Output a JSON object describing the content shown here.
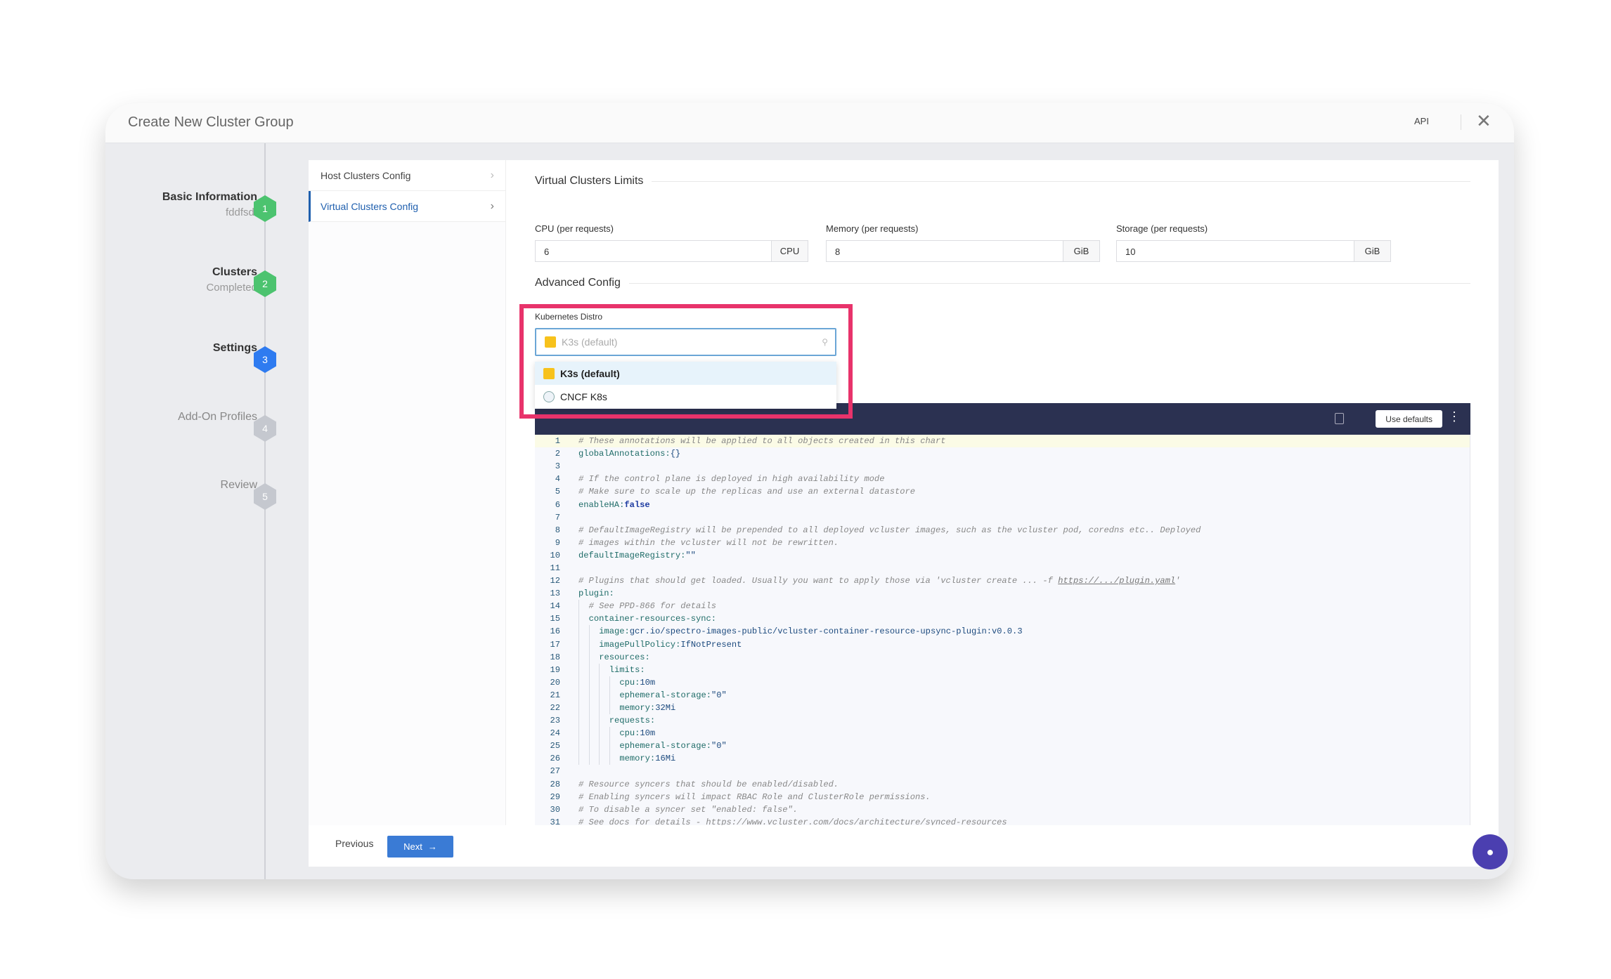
{
  "header": {
    "title": "Create New Cluster Group",
    "api": "API"
  },
  "steps": [
    {
      "label": "Basic Information",
      "sub": "fddfsdf",
      "num": "1",
      "color": "#4cc36f"
    },
    {
      "label": "Clusters",
      "sub": "Completed",
      "num": "2",
      "color": "#4cc36f"
    },
    {
      "label": "Settings",
      "sub": "",
      "num": "3",
      "color": "#2e7bf0"
    },
    {
      "label": "Add-On Profiles",
      "sub": "",
      "num": "4",
      "color": "#c5c8cf"
    },
    {
      "label": "Review",
      "sub": "",
      "num": "5",
      "color": "#c5c8cf"
    }
  ],
  "subnav": [
    {
      "label": "Host Clusters Config"
    },
    {
      "label": "Virtual Clusters Config",
      "active": true
    }
  ],
  "limits": {
    "title": "Virtual Clusters Limits",
    "cpu": {
      "label": "CPU (per requests)",
      "value": "6",
      "unit": "CPU"
    },
    "memory": {
      "label": "Memory (per requests)",
      "value": "8",
      "unit": "GiB"
    },
    "storage": {
      "label": "Storage (per requests)",
      "value": "10",
      "unit": "GiB"
    }
  },
  "advanced": {
    "title": "Advanced Config",
    "distro_label": "Kubernetes Distro",
    "distro_placeholder": "K3s (default)",
    "options": [
      {
        "label": "K3s (default)",
        "icon": "k3s-icon",
        "selected": true
      },
      {
        "label": "CNCF K8s",
        "icon": "cncf-icon"
      }
    ],
    "highlight_color": "#e8336b"
  },
  "editor": {
    "use_defaults": "Use defaults",
    "lines": [
      {
        "c": "# These annotations will be applied to all objects created in this chart"
      },
      {
        "k": "globalAnnotations",
        "v": "{}"
      },
      {},
      {
        "c": "# If the control plane is deployed in high availability mode"
      },
      {
        "c": "# Make sure to scale up the replicas and use an external datastore"
      },
      {
        "k": "enableHA",
        "b": "false"
      },
      {},
      {
        "c": "# DefaultImageRegistry will be prepended to all deployed vcluster images, such as the vcluster pod, coredns etc.. Deployed"
      },
      {
        "c": "# images within the vcluster will not be rewritten."
      },
      {
        "k": "defaultImageRegistry",
        "v": "\"\""
      },
      {},
      {
        "c": "# Plugins that should get loaded. Usually you want to apply those via 'vcluster create ... -f ",
        "link": "https://.../plugin.yaml",
        "c2": "'"
      },
      {
        "k": "plugin"
      },
      {
        "i": 1,
        "c": "# See PPD-866 for details"
      },
      {
        "i": 1,
        "k": "container-resources-sync"
      },
      {
        "i": 2,
        "k": "image",
        "v": "gcr.io/spectro-images-public/vcluster-container-resource-upsync-plugin:v0.0.3"
      },
      {
        "i": 2,
        "k": "imagePullPolicy",
        "v": "IfNotPresent"
      },
      {
        "i": 2,
        "k": "resources"
      },
      {
        "i": 3,
        "k": "limits"
      },
      {
        "i": 4,
        "k": "cpu",
        "v": "10m"
      },
      {
        "i": 4,
        "k": "ephemeral-storage",
        "v": "\"0\""
      },
      {
        "i": 4,
        "k": "memory",
        "v": "32Mi"
      },
      {
        "i": 3,
        "k": "requests"
      },
      {
        "i": 4,
        "k": "cpu",
        "v": "10m"
      },
      {
        "i": 4,
        "k": "ephemeral-storage",
        "v": "\"0\""
      },
      {
        "i": 4,
        "k": "memory",
        "v": "16Mi"
      },
      {},
      {
        "c": "# Resource syncers that should be enabled/disabled."
      },
      {
        "c": "# Enabling syncers will impact RBAC Role and ClusterRole permissions."
      },
      {
        "c": "# To disable a syncer set \"enabled: false\"."
      },
      {
        "c": "# See docs for details - https://www.vcluster.com/docs/architecture/synced-resources"
      }
    ]
  },
  "footer": {
    "previous": "Previous",
    "next": "Next"
  }
}
